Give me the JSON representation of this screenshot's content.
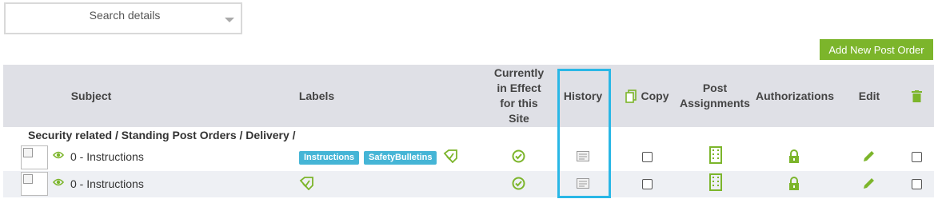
{
  "search": {
    "placeholder": "Search details"
  },
  "toolbar": {
    "add_label": "Add New Post Order"
  },
  "table": {
    "headers": {
      "subject": "Subject",
      "labels": "Labels",
      "current_l1": "Currently",
      "current_l2": "in Effect",
      "current_l3": "for this",
      "current_l4": "Site",
      "history": "History",
      "copy": "Copy",
      "post_l1": "Post",
      "post_l2": "Assignments",
      "authorizations": "Authorizations",
      "edit": "Edit"
    },
    "group_title": "Security related / Standing Post Orders / Delivery /",
    "rows": [
      {
        "subject": "0 - Instructions",
        "labels": [
          "Instructions",
          "SafetyBulletins"
        ]
      },
      {
        "subject": "0 - Instructions",
        "labels": []
      }
    ]
  },
  "colors": {
    "accent_green": "#7cb52b",
    "label_blue": "#45b5d6",
    "highlight": "#29b7e6",
    "header_bg": "#dfe0e6"
  },
  "icons": [
    "chevron-down-icon",
    "copy-icon",
    "trash-icon",
    "eye-icon",
    "tag-icon",
    "check-circle-icon",
    "history-icon",
    "building-icon",
    "lock-icon",
    "pencil-icon"
  ]
}
